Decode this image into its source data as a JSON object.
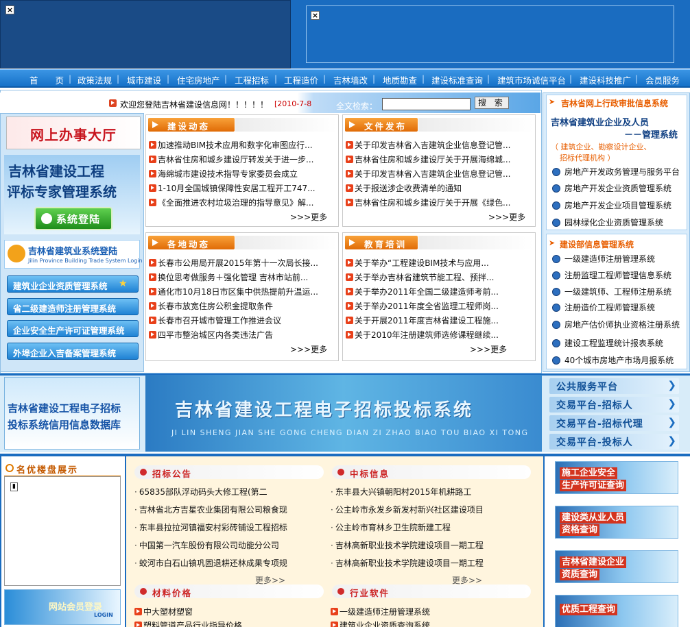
{
  "nav": [
    "首　　页",
    "政策法规",
    "城市建设",
    "住宅房地产",
    "工程招标",
    "工程造价",
    "吉林墙改",
    "地质勘查",
    "建设标准查询",
    "建筑市场诚信平台",
    "建设科技推广",
    "会员服务"
  ],
  "welcome": {
    "text": "欢迎您登陆吉林省建设信息网！！！！！",
    "date": "[2010-7-8",
    "search_label": "全文检索：",
    "search_btn": "搜 索"
  },
  "left": {
    "hall": "网上办事大厅",
    "expert1": "吉林省建设工程",
    "expert2": "评标专家管理系统",
    "login": "系统登陆",
    "trade_title": "吉林省建筑业系统登陆",
    "trade_sub": "Jilin Province Building Trade System Login",
    "btns": [
      "建筑业企业资质管理系统",
      "省二级建造师注册管理系统",
      "企业安全生产许可证管理系统",
      "外埠企业入吉备案管理系统"
    ]
  },
  "panels": {
    "jsdt": {
      "title": "建设动态",
      "items": [
        "加速推动BIM技术应用和数字化审图应行...",
        "吉林省住房和城乡建设厅转发关于进一步...",
        "海绵城市建设技术指导专家委员会成立",
        "1-10月全国城镇保障性安居工程开工747...",
        "《全面推进农村垃圾治理的指导意见》解..."
      ],
      "more": ">>>更多"
    },
    "wjfb": {
      "title": "文件发布",
      "items": [
        "关于印发吉林省入吉建筑企业信息登记管...",
        "吉林省住房和城乡建设厅关于开展海绵城...",
        "关于印发吉林省入吉建筑企业信息登记管...",
        "关于报送涉企收费清单的通知",
        "吉林省住房和城乡建设厅关于开展《绿色..."
      ],
      "more": ">>>更多"
    },
    "gddt": {
      "title": "各地动态",
      "items": [
        "长春市公用局开展2015年第十一次局长接...",
        "换位思考做服务＋强化管理 吉林市站前...",
        "通化市10月18日市区集中供热提前升温运...",
        "长春市放宽住房公积金提取条件",
        "长春市召开城市管理工作推进会议",
        "四平市整治城区内各类违法广告"
      ],
      "more": ">>>更多"
    },
    "jypx": {
      "title": "教育培训",
      "items": [
        "关于举办“工程建设BIM技术与应用...",
        "关于举办吉林省建筑节能工程、预拌...",
        "关于举办2011年全国二级建造师考前...",
        "关于举办2011年度全省监理工程师岗...",
        "关于开展2011年度吉林省建设工程施...",
        "关于2010年注册建筑师选修课程继续..."
      ],
      "more": ">>>更多"
    }
  },
  "right": {
    "title1": "吉林省网上行政审批信息系统",
    "sys1": "吉林省建筑业企业及人员",
    "sys2": "－－管理系统",
    "sys_note1": "（ 建筑企业、勘察设计企业、",
    "sys_note2": "招标代理机构 ）",
    "items1": [
      "房地产开发政务管理与服务平台",
      "房地产开发企业资质管理系统",
      "房地产开发企业项目管理系统",
      "园林绿化企业资质管理系统"
    ],
    "title2": "建设部信息管理系统",
    "items2": [
      "一级建造师注册管理系统",
      "注册监理工程师管理信息系统",
      "一级建筑师、工程师注册系统",
      "注册造价工程师管理系统",
      "房地产估价师执业资格注册系统",
      "建设工程监理统计报表系统",
      "40个城市房地产市场月报系统"
    ]
  },
  "ebid": {
    "title": "吉林省建设工程电子招标投标系统",
    "sub": "JI LIN SHENG JIAN SHE GONG CHENG DIAN ZI ZHAO BIAO TOU BIAO XI TONG",
    "left1": "吉林省建设工程电子招标",
    "left2": "投标系统信用信息数据库",
    "platforms": [
      "公共服务平台",
      "交易平台-招标人",
      "交易平台-招标代理",
      "交易平台-投标人"
    ]
  },
  "bottom": {
    "showcase": "名优楼盘展示",
    "member": "网站会员登录",
    "member_sub": "LOGIN",
    "zbgg": {
      "title": "招标公告",
      "items": [
        "65835部队浮动码头大修工程(第二",
        "吉林省北方吉星农业集团有限公司粮食现",
        "东丰县拉拉河镇福安村彩砖铺设工程招标",
        "中国第一汽车股份有限公司动能分公司",
        "蛟河市白石山镇巩固退耕还林成果专项规"
      ],
      "more": "更多>>"
    },
    "zbxx": {
      "title": "中标信息",
      "items": [
        "东丰县大兴镇朝阳村2015年机耕路工",
        "公主岭市永发乡新发村新兴社区建设项目",
        "公主岭市育林乡卫生院新建工程",
        "吉林高新职业技术学院建设项目一期工程",
        "吉林高新职业技术学院建设项目一期工程"
      ],
      "more": "更多>>"
    },
    "cljg": {
      "title": "材料价格",
      "items": [
        "中大塑材塑窗",
        "塑料管道产品行业指导价格"
      ]
    },
    "hyrj": {
      "title": "行业软件",
      "items": [
        "一级建造师注册管理系统",
        "建筑业企业资质查询系统"
      ]
    },
    "queries": [
      "施工企业安全|生产许可证查询",
      "建设类从业人员|资格查询",
      "吉林省建设企业|资质查询",
      "优质工程查询"
    ]
  }
}
